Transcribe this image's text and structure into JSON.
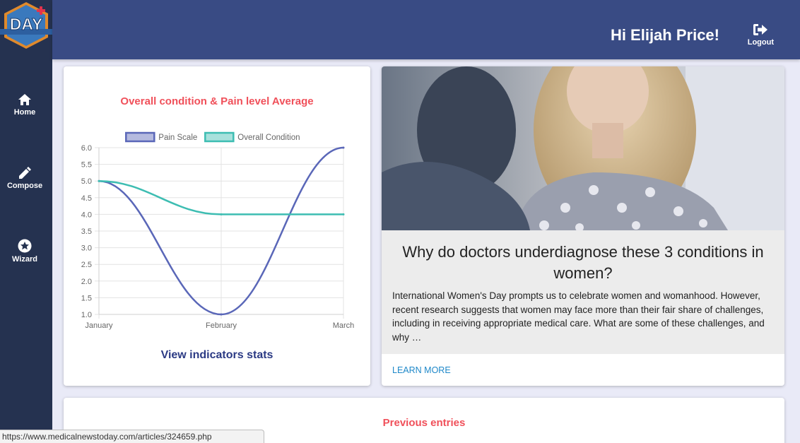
{
  "app": {
    "logo_text": "DAY"
  },
  "sidebar": {
    "items": [
      {
        "label": "Home",
        "icon": "home-icon"
      },
      {
        "label": "Compose",
        "icon": "pencil-icon"
      },
      {
        "label": "Wizard",
        "icon": "star-circle-icon"
      }
    ]
  },
  "header": {
    "greeting": "Hi Elijah Price!",
    "logout_label": "Logout",
    "logout_icon": "logout-icon"
  },
  "chart_card": {
    "link_label": "View indicators stats"
  },
  "chart_data": {
    "type": "line",
    "title": "Overall condition & Pain level Average",
    "categories": [
      "January",
      "February",
      "March"
    ],
    "series": [
      {
        "name": "Pain Scale",
        "values": [
          5.0,
          1.0,
          6.0
        ],
        "color": "#5a67b8"
      },
      {
        "name": "Overall Condition",
        "values": [
          5.0,
          4.0,
          4.0
        ],
        "color": "#3dbdb2"
      }
    ],
    "ylim": [
      1.0,
      6.0
    ],
    "yticks": [
      "6.0",
      "5.5",
      "5.0",
      "4.5",
      "4.0",
      "3.5",
      "3.0",
      "2.5",
      "2.0",
      "1.5",
      "1.0"
    ],
    "grid": true,
    "legend": "top"
  },
  "article": {
    "title": "Why do doctors underdiagnose these 3 conditions in women?",
    "excerpt": "International Women's Day prompts us to celebrate women and womanhood. However, recent research suggests that women may face more than their fair share of challenges, including in receiving appropriate medical care. What are some of these challenges, and why …",
    "cta_label": "LEARN MORE"
  },
  "entries": {
    "title": "Previous entries"
  },
  "status_bar": {
    "url": "https://www.medicalnewstoday.com/articles/324659.php"
  },
  "colors": {
    "sidebar": "#253250",
    "header": "#394b84",
    "accent_red": "#f0505a",
    "link_blue": "#1e88c9"
  }
}
